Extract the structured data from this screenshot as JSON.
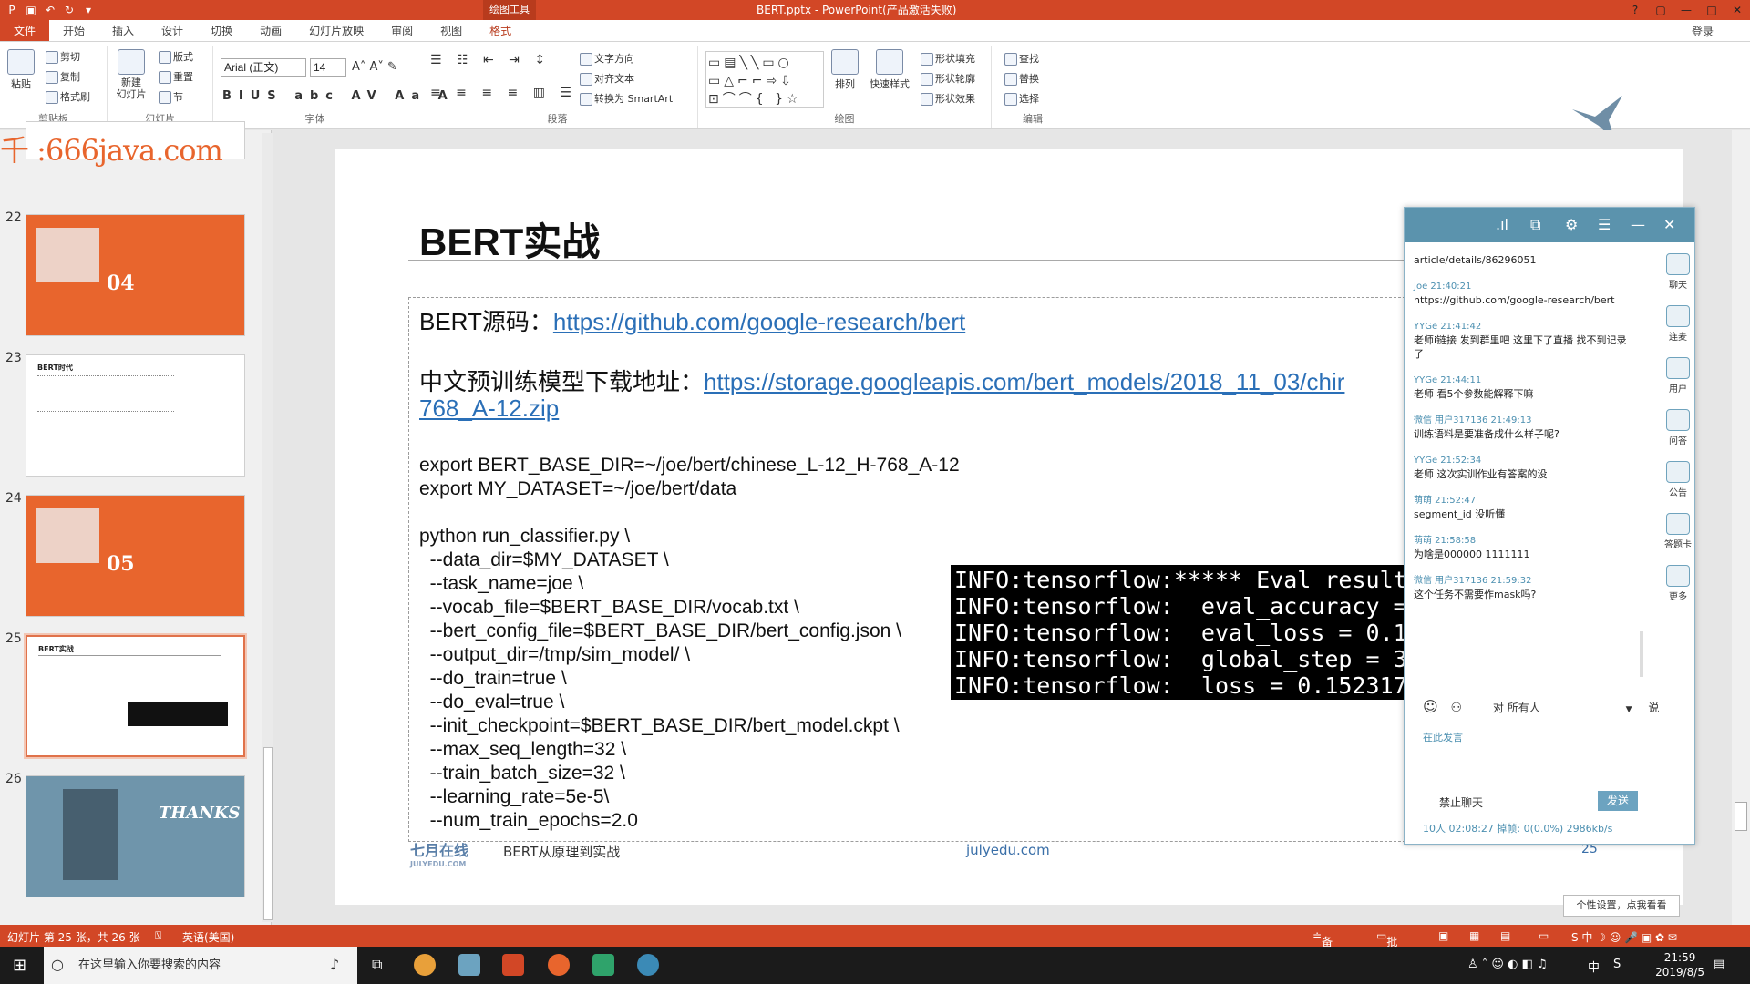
{
  "window": {
    "qat_icons": [
      "powerpoint-icon",
      "save-icon",
      "undo-icon",
      "redo-icon",
      "customize-icon"
    ],
    "contextual_tab": "绘图工具",
    "title": "BERT.pptx - PowerPoint(产品激活失败)",
    "controls": [
      "?",
      "▢",
      "—",
      "□",
      "✕"
    ]
  },
  "ribbon_tabs": [
    "文件",
    "开始",
    "插入",
    "设计",
    "切换",
    "动画",
    "幻灯片放映",
    "审阅",
    "视图",
    "格式"
  ],
  "login": "登录",
  "ribbon": {
    "clipboard": {
      "paste": "粘贴",
      "cut": "剪切",
      "copy": "复制",
      "format_painter": "格式刷",
      "label": "剪贴板"
    },
    "slides": {
      "new_slide": "新建\n幻灯片",
      "layout": "版式",
      "reset": "重置",
      "section": "节",
      "label": "幻灯片"
    },
    "font": {
      "name": "Arial (正文)",
      "size": "14",
      "label": "字体"
    },
    "paragraph": {
      "text_direction": "文字方向",
      "align_text": "对齐文本",
      "smartart": "转换为 SmartArt",
      "label": "段落"
    },
    "drawing": {
      "arrange": "排列",
      "quick_styles": "快速样式",
      "shape_fill": "形状填充",
      "shape_outline": "形状轮廓",
      "shape_effects": "形状效果",
      "label": "绘图"
    },
    "editing": {
      "find": "查找",
      "replace": "替换",
      "select": "选择",
      "label": "编辑"
    }
  },
  "thumbnails": {
    "watermark": "千 :666java.com",
    "items": [
      {
        "num": "22",
        "caption": "04"
      },
      {
        "num": "23",
        "caption": "BERT时代"
      },
      {
        "num": "24",
        "caption": "05"
      },
      {
        "num": "25",
        "caption": "BERT实战"
      },
      {
        "num": "26",
        "caption": "THANKS"
      }
    ]
  },
  "slide": {
    "title": "BERT实战",
    "line1_label": "BERT源码：",
    "line1_link": "https://github.com/google-research/bert",
    "line2_label": "中文预训练模型下载地址：",
    "line2_link": "https://storage.googleapis.com/bert_models/2018_11_03/chir",
    "line2_link_cont": "768_A-12.zip",
    "code": [
      "export BERT_BASE_DIR=~/joe/bert/chinese_L-12_H-768_A-12",
      "export MY_DATASET=~/joe/bert/data",
      "",
      "python run_classifier.py \\",
      "  --data_dir=$MY_DATASET \\",
      "  --task_name=joe \\",
      "  --vocab_file=$BERT_BASE_DIR/vocab.txt \\",
      "  --bert_config_file=$BERT_BASE_DIR/bert_config.json \\",
      "  --output_dir=/tmp/sim_model/ \\",
      "  --do_train=true \\",
      "  --do_eval=true \\",
      "  --init_checkpoint=$BERT_BASE_DIR/bert_model.ckpt \\",
      "  --max_seq_length=32 \\",
      "  --train_batch_size=32 \\",
      "  --learning_rate=5e-5\\",
      "  --num_train_epochs=2.0"
    ],
    "terminal": [
      "INFO:tensorflow:***** Eval result",
      "INFO:tensorflow:  eval_accuracy =",
      "INFO:tensorflow:  eval_loss = 0.1",
      "INFO:tensorflow:  global_step = 3",
      "INFO:tensorflow:  loss = 0.152317"
    ],
    "footer_logo": "七月在线",
    "footer_logo_sub": "JULYEDU.COM",
    "footer_text": "BERT从原理到实战",
    "footer_url": "julyedu.com",
    "footer_num": "25"
  },
  "chat": {
    "header_icons": [
      "signal-icon",
      "window-icon",
      "settings-icon",
      "menu-icon",
      "minimize-icon",
      "close-icon"
    ],
    "messages": [
      {
        "who": "",
        "text": "article/details/86296051"
      },
      {
        "who": "Joe 21:40:21",
        "text": "https://github.com/google-research/bert"
      },
      {
        "who": "YYGe 21:41:42",
        "text": "老师i链接  发到群里吧  这里下了直播  找不到记录了"
      },
      {
        "who": "YYGe 21:44:11",
        "text": "老师  看5个参数能解释下嘛"
      },
      {
        "who": "微信  用户317136 21:49:13",
        "text": "训练语料是要准备成什么样子呢?"
      },
      {
        "who": "YYGe 21:52:34",
        "text": "老师  这次实训作业有答案的没"
      },
      {
        "who": "萌萌 21:52:47",
        "text": "segment_id  没听懂"
      },
      {
        "who": "萌萌 21:58:58",
        "text": "为啥是000000  1111111"
      },
      {
        "who": "微信  用户317136 21:59:32",
        "text": "这个任务不需要作mask吗?"
      }
    ],
    "side": [
      "聊天",
      "连麦",
      "用户",
      "问答",
      "公告",
      "答题卡",
      "更多"
    ],
    "to_label": "对  所有人",
    "say": "说",
    "hint": "在此发言",
    "ban": "禁止聊天",
    "send": "发送",
    "status": "10人  02:08:27  掉帧: 0(0.0%)  2986kb/s"
  },
  "tip": "个性设置，点我看看",
  "statusbar": {
    "slide_info": "幻灯片 第 25 张，共 26 张",
    "lang": "英语(美国)",
    "notes": "备注",
    "comments": "批注"
  },
  "taskbar": {
    "search": "在这里输入你要搜索的内容",
    "time": "21:59",
    "date": "2019/8/5",
    "ime": "中"
  }
}
